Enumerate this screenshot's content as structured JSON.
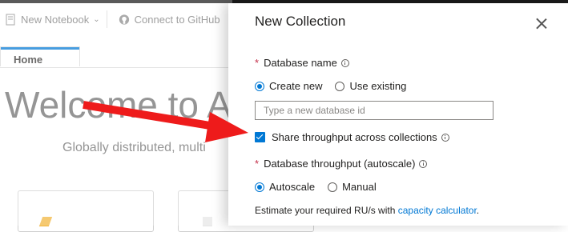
{
  "app": {
    "toolbar": {
      "new_notebook": "New Notebook",
      "connect_github": "Connect to GitHub"
    },
    "tabs": [
      {
        "label": "Home"
      }
    ],
    "welcome_title": "Welcome to A",
    "welcome_subtitle": "Globally distributed, multi"
  },
  "panel": {
    "title": "New Collection",
    "database_name": {
      "label": "Database name",
      "options": [
        "Create new",
        "Use existing"
      ],
      "selected": "Create new",
      "input_value": "",
      "input_placeholder": "Type a new database id"
    },
    "share_throughput": {
      "label": "Share throughput across collections",
      "checked": true
    },
    "throughput": {
      "label": "Database throughput (autoscale)",
      "options": [
        "Autoscale",
        "Manual"
      ],
      "selected": "Autoscale"
    },
    "estimate": {
      "text": "Estimate your required RU/s with ",
      "link": "capacity calculator",
      "suffix": "."
    }
  },
  "colors": {
    "accent": "#0078d4",
    "required": "#c4314b",
    "annotation_arrow": "#ee1b1b"
  }
}
